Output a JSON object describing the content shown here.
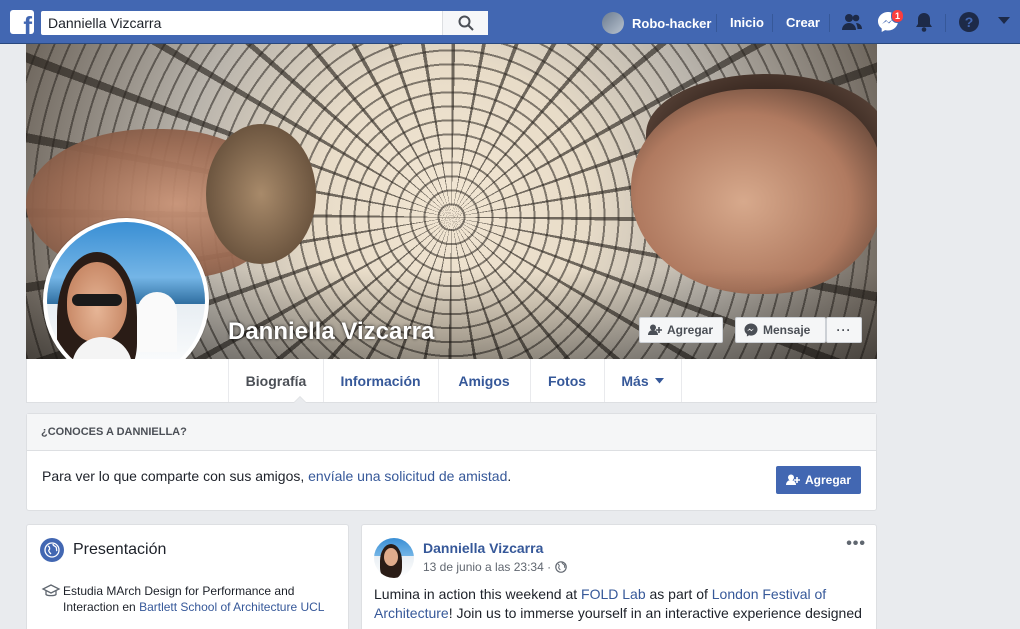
{
  "topbar": {
    "search_value": "Danniella Vizcarra",
    "user_name": "Robo-hacker",
    "home_label": "Inicio",
    "create_label": "Crear",
    "messages_badge": "1"
  },
  "profile": {
    "name": "Danniella Vizcarra",
    "add_friend_label": "Agregar",
    "message_label": "Mensaje",
    "more_label": "···"
  },
  "tabs": [
    {
      "label": "Biografía",
      "active": true
    },
    {
      "label": "Información"
    },
    {
      "label": "Amigos"
    },
    {
      "label": "Fotos"
    },
    {
      "label": "Más"
    }
  ],
  "know_box": {
    "header": "¿CONOCES A DANNIELLA?",
    "text_before": "Para ver lo que comparte con sus amigos, ",
    "link": "envíale una solicitud de amistad",
    "text_after": ".",
    "button_label": "Agregar"
  },
  "intro": {
    "title": "Presentación",
    "study_prefix": "Estudia MArch Design for Performance and Interaction en ",
    "study_link": "Bartlett School of Architecture UCL"
  },
  "post": {
    "author": "Danniella Vizcarra",
    "timestamp": "13 de junio a las 23:34 ·",
    "more": "•••",
    "text_1": "Lumina in action this weekend at ",
    "link_1": "FOLD Lab",
    "text_2": " as part of ",
    "link_2": "London Festival of Architecture",
    "text_3": "! Join us to immerse yourself in an interactive experience designed"
  },
  "colors": {
    "brand": "#4267b2",
    "link": "#365899",
    "badge": "#fa3e3e"
  }
}
